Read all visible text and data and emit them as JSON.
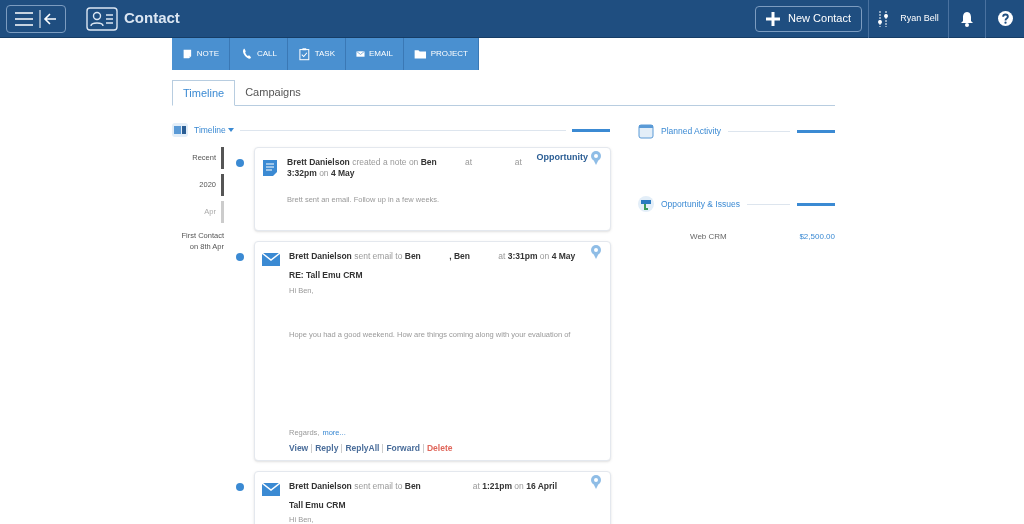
{
  "header": {
    "title": "Contact",
    "new_button": "New Contact",
    "user": "Ryan Bell"
  },
  "actions": [
    {
      "kind": "note",
      "label": "NOTE"
    },
    {
      "kind": "call",
      "label": "CALL"
    },
    {
      "kind": "task",
      "label": "TASK"
    },
    {
      "kind": "email",
      "label": "EMAIL"
    },
    {
      "kind": "project",
      "label": "PROJECT"
    }
  ],
  "tabs": [
    {
      "label": "Timeline",
      "selected": true
    },
    {
      "label": "Campaigns",
      "selected": false
    }
  ],
  "timeline": {
    "title": "Timeline",
    "nav": [
      {
        "label": "Recent",
        "selected": true
      },
      {
        "label": "2020",
        "selected": true
      },
      {
        "label": "Apr",
        "selected": false
      }
    ],
    "first_contact": "First Contact on 8th Apr"
  },
  "entries": [
    {
      "kind": "note",
      "tag": "Opportunity",
      "headline": "**Brett Danielson** created a note on **Ben**            at                  at **3:32pm** on **4 May**",
      "body": [
        "Brett sent an email. Follow up in a few weeks."
      ]
    },
    {
      "kind": "email",
      "headline": "**Brett Danielson** sent email to **Ben**            **, Ben**            at **3:31pm** on **4 May**",
      "subject": "RE: Tall Emu CRM",
      "body": [
        "Hi Ben,",
        "Hope you had a good weekend. How are things coming along with your evaluation of"
      ],
      "closing": "Regards,",
      "more": "more...",
      "links": [
        "View",
        "Reply",
        "ReplyAll",
        "Forward",
        "Delete"
      ]
    },
    {
      "kind": "email",
      "headline": "**Brett Danielson** sent email to **Ben**                      at **1:21pm** on **16 April**",
      "subject": "Tall Emu CRM",
      "body": [
        "Hi Ben,"
      ]
    }
  ],
  "planned": {
    "title": "Planned Activity"
  },
  "opportunities": {
    "title": "Opportunity & Issues",
    "items": [
      {
        "name": "Web CRM",
        "amount": "$2,500.00"
      }
    ]
  }
}
